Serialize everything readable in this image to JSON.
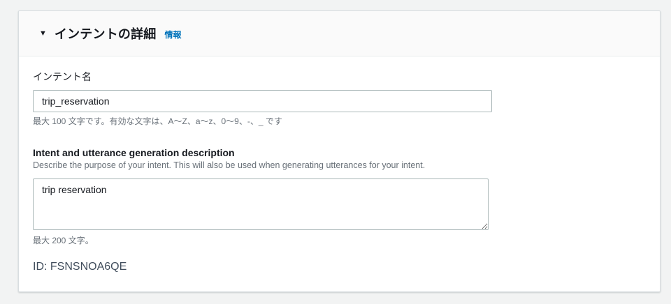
{
  "section": {
    "title": "インテントの詳細",
    "info_link": "情報",
    "caret_icon": "▼"
  },
  "fields": {
    "intent_name": {
      "label": "インテント名",
      "value": "trip_reservation",
      "constraint": "最大 100 文字です。有効な文字は、A～Z、a～z、0～9、-、_ です"
    },
    "description": {
      "label": "Intent and utterance generation description",
      "help_text": "Describe the purpose of your intent. This will also be used when generating utterances for your intent.",
      "value": "trip reservation",
      "constraint": "最大 200 文字。"
    }
  },
  "id_line": "ID: FSNSNOA6QE",
  "colors": {
    "page_background": "#f2f3f3",
    "card_background": "#ffffff",
    "header_background": "#fafafa",
    "link_blue": "#0073bb",
    "text_dark": "#16191f",
    "text_secondary": "#687078",
    "input_border": "#aab7b8"
  }
}
